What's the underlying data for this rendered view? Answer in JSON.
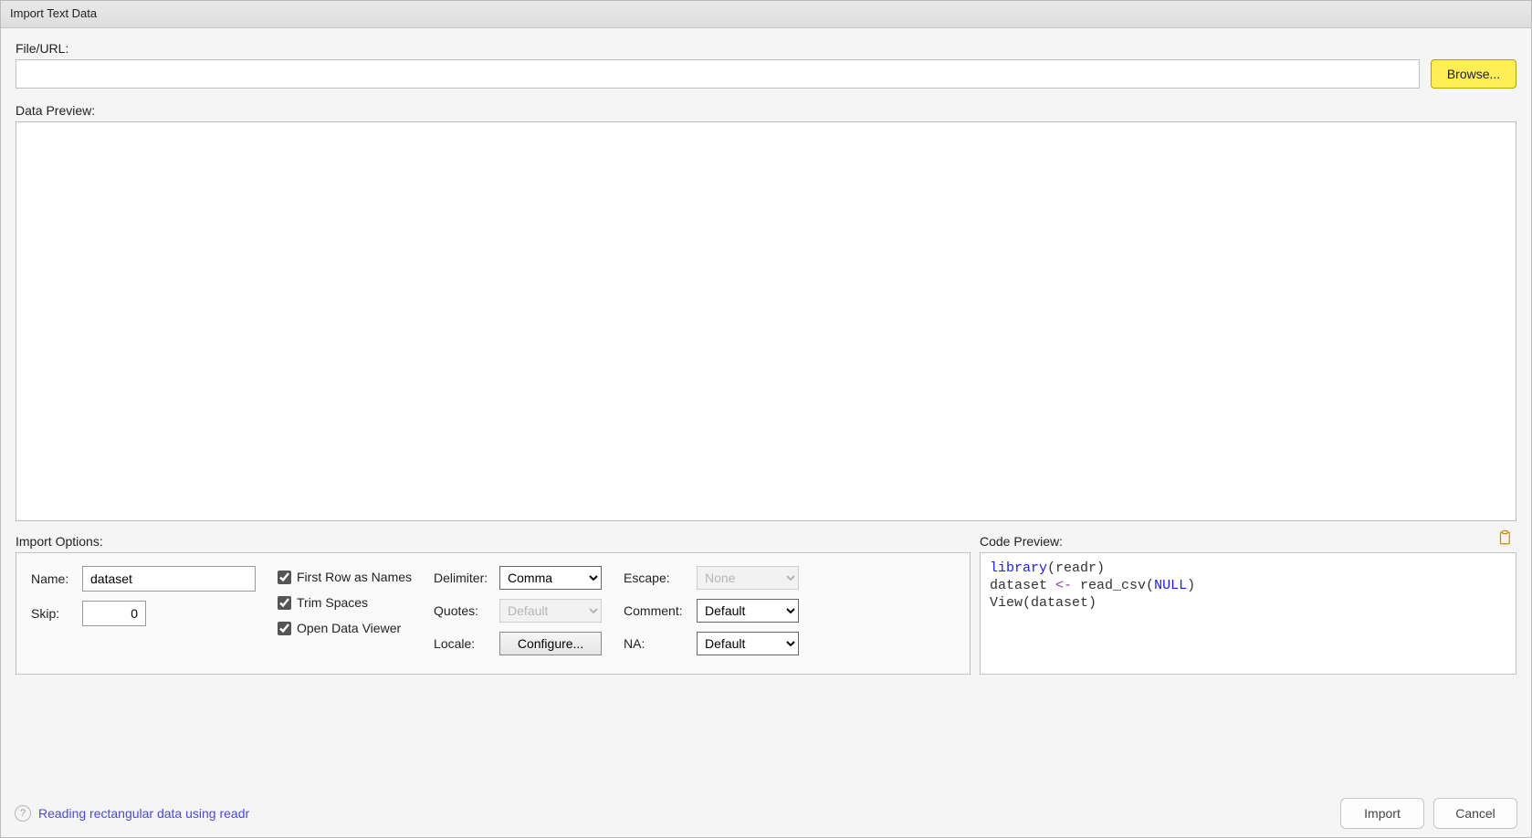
{
  "title": "Import Text Data",
  "labels": {
    "file_url": "File/URL:",
    "data_preview": "Data Preview:",
    "import_options": "Import Options:",
    "code_preview": "Code Preview:"
  },
  "file": {
    "value": "",
    "browse": "Browse..."
  },
  "options": {
    "name_label": "Name:",
    "name_value": "dataset",
    "skip_label": "Skip:",
    "skip_value": "0",
    "first_row": "First Row as Names",
    "trim_spaces": "Trim Spaces",
    "open_viewer": "Open Data Viewer",
    "delimiter_label": "Delimiter:",
    "delimiter_value": "Comma",
    "quotes_label": "Quotes:",
    "quotes_value": "Default",
    "locale_label": "Locale:",
    "configure_btn": "Configure...",
    "escape_label": "Escape:",
    "escape_value": "None",
    "comment_label": "Comment:",
    "comment_value": "Default",
    "na_label": "NA:",
    "na_value": "Default"
  },
  "code": {
    "library_kw": "library",
    "library_arg_open": "(",
    "library_arg": "readr",
    "library_arg_close": ")",
    "assign_lhs": "dataset ",
    "assign_op": "<-",
    "read_fn": " read_csv",
    "read_open": "(",
    "read_null": "NULL",
    "read_close": ")",
    "view_fn": "View",
    "view_open": "(",
    "view_arg": "dataset",
    "view_close": ")"
  },
  "footer": {
    "help_text": "Reading rectangular data using readr",
    "import": "Import",
    "cancel": "Cancel"
  }
}
